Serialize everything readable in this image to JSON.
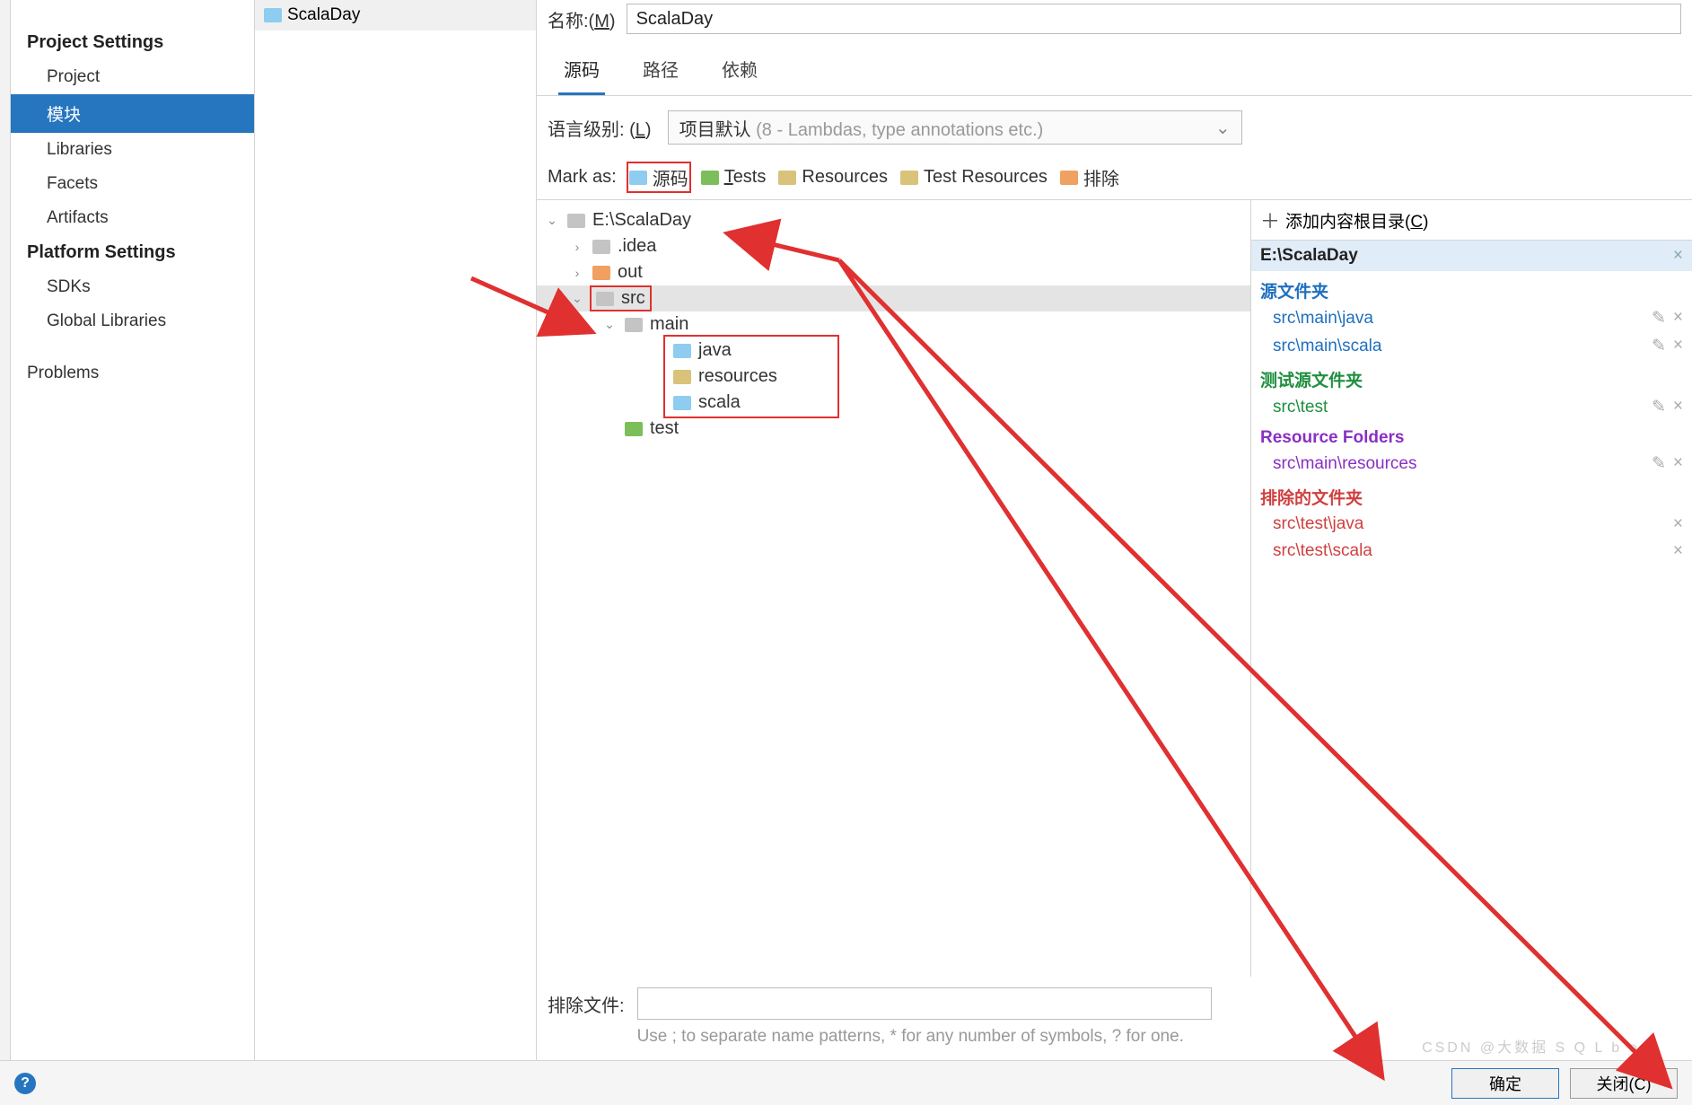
{
  "sidebar": {
    "group1_title": "Project Settings",
    "items1": [
      "Project",
      "模块",
      "Libraries",
      "Facets",
      "Artifacts"
    ],
    "group2_title": "Platform Settings",
    "items2": [
      "SDKs",
      "Global Libraries"
    ],
    "problems": "Problems",
    "selected": "模块"
  },
  "moduleTree": {
    "root": "ScalaDay"
  },
  "nameRow": {
    "label_prefix": "名称:(",
    "label_key": "M",
    "label_suffix": ")",
    "value": "ScalaDay"
  },
  "tabs": [
    "源码",
    "路径",
    "依赖"
  ],
  "activeTab": "源码",
  "lang": {
    "label_prefix": "语言级别:  (",
    "label_key": "L",
    "label_suffix": ")",
    "value": "项目默认",
    "hint": "(8 - Lambdas, type annotations etc.)"
  },
  "markAs": {
    "label": "Mark as:",
    "sources": "源码",
    "tests": "Tests",
    "tests_key": "T",
    "resources": "Resources",
    "test_resources": "Test Resources",
    "excluded": "排除"
  },
  "fileTree": {
    "root": "E:\\ScalaDay",
    "nodes": [
      {
        "name": ".idea",
        "type": "gray",
        "depth": 1,
        "exp": "›"
      },
      {
        "name": "out",
        "type": "orange",
        "depth": 1,
        "exp": "›"
      },
      {
        "name": "src",
        "type": "gray",
        "depth": 1,
        "exp": "⌄",
        "sel": true,
        "boxed": true
      },
      {
        "name": "main",
        "type": "gray",
        "depth": 2,
        "exp": "⌄"
      },
      {
        "name": "java",
        "type": "blue",
        "depth": 3,
        "boxed_group": true
      },
      {
        "name": "resources",
        "type": "yellow",
        "depth": 3,
        "boxed_group": true
      },
      {
        "name": "scala",
        "type": "blue",
        "depth": 3,
        "boxed_group": true
      },
      {
        "name": "test",
        "type": "green",
        "depth": 2
      }
    ]
  },
  "contentRoots": {
    "addLabel_prefix": "添加内容根目录(",
    "addLabel_key": "C",
    "addLabel_suffix": ")",
    "root": "E:\\ScalaDay",
    "sourcesTitle": "源文件夹",
    "sources": [
      "src\\main\\java",
      "src\\main\\scala"
    ],
    "testsTitle": "测试源文件夹",
    "tests": [
      "src\\test"
    ],
    "resourcesTitle": "Resource Folders",
    "resources": [
      "src\\main\\resources"
    ],
    "excludedTitle": "排除的文件夹",
    "excluded": [
      "src\\test\\java",
      "src\\test\\scala"
    ]
  },
  "excludeRow": {
    "label": "排除文件:",
    "hint": "Use ; to separate name patterns, * for any number of symbols, ? for one."
  },
  "footer": {
    "ok": "确定",
    "close": "关闭(C)"
  },
  "watermark": "CSDN @大数据 S Q L b o y"
}
